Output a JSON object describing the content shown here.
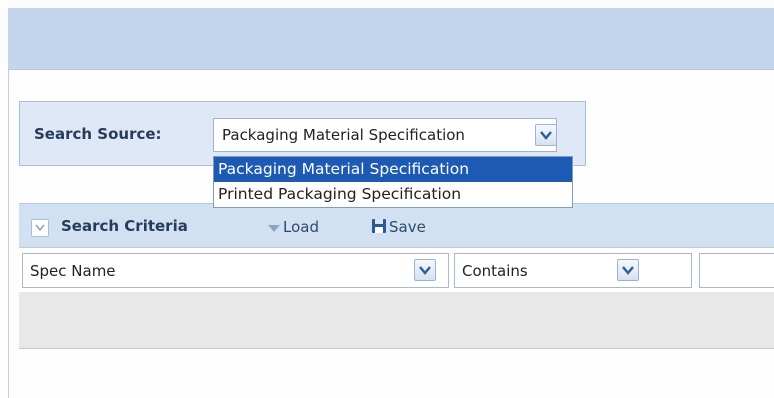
{
  "search_source": {
    "label": "Search Source:",
    "selected_value": "Packaging Material Specification",
    "options": [
      "Packaging Material Specification",
      "Printed Packaging Specification"
    ],
    "highlighted_option_index": 0
  },
  "search_criteria": {
    "title": "Search Criteria",
    "load_label": "Load",
    "save_label": "Save",
    "field_select_value": "Spec Name",
    "operator_select_value": "Contains",
    "value_input": ""
  },
  "colors": {
    "header_band": "#c3d6ee",
    "panel_bg": "#dfe8f6",
    "highlight": "#1c5ab4",
    "label_text": "#253d5b"
  }
}
